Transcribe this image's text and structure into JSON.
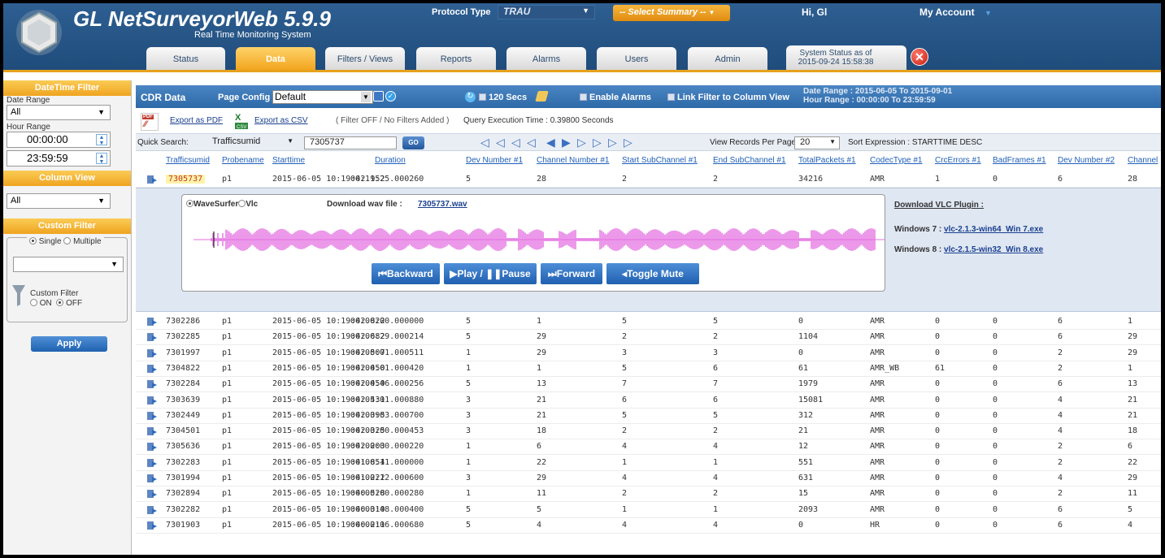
{
  "app": {
    "title": "GL NetSurveyorWeb 5.9.9",
    "subtitle": "Real Time Monitoring System",
    "protocol_label": "Protocol Type",
    "protocol_value": "TRAU",
    "summary_select": "-- Select Summary --",
    "greeting": "Hi, Gl",
    "my_account": "My Account"
  },
  "tabs": [
    {
      "label": "Status"
    },
    {
      "label": "Data"
    },
    {
      "label": "Filters / Views"
    },
    {
      "label": "Reports"
    },
    {
      "label": "Alarms"
    },
    {
      "label": "Users"
    },
    {
      "label": "Admin"
    }
  ],
  "system_status": {
    "line1": "System Status as of",
    "line2": "2015-09-24 15:58:38"
  },
  "sidebar": {
    "datetime_filter": "DateTime Filter",
    "date_range_label": "Date Range",
    "date_range_value": "All",
    "hour_range_label": "Hour Range",
    "hour_from": "00:00:00",
    "hour_to": "23:59:59",
    "column_view": "Column View",
    "column_view_value": "All",
    "custom_filter": "Custom Filter",
    "single": "Single",
    "multiple": "Multiple",
    "custom_filter_value": "",
    "custom_filter_toggle": "Custom Filter",
    "on": "ON",
    "off": "OFF",
    "apply": "Apply"
  },
  "toolbar": {
    "cdr_data": "CDR Data",
    "page_config_label": "Page Config",
    "page_config_value": "Default",
    "refresh_interval": "120 Secs",
    "enable_alarms": "Enable Alarms",
    "link_filter": "Link Filter to Column View",
    "date_range": "Date Range : 2015-06-05 To 2015-09-01",
    "hour_range": "Hour Range : 00:00:00 To 23:59:59"
  },
  "export": {
    "pdf": "Export as PDF",
    "csv": "Export as CSV",
    "filter_note": "( Filter OFF / No Filters Added )",
    "query_time": "Query Execution Time : 0.39800 Seconds"
  },
  "search": {
    "label": "Quick Search:",
    "field": "Trafficsumid",
    "value": "7305737",
    "go": "GO",
    "records_label": "View Records Per Page:",
    "records_value": "20",
    "sort_expression": "Sort Expression : STARTTIME DESC"
  },
  "columns": [
    "Trafficsumid",
    "Probename",
    "Starttime",
    "Duration",
    "Dev Number #1",
    "Channel Number #1",
    "Start SubChannel #1",
    "End SubChannel #1",
    "TotalPackets #1",
    "CodecType #1",
    "CrcErrors #1",
    "BadFrames #1",
    "Dev Number #2",
    "Channel"
  ],
  "rows": [
    [
      "7305737",
      "p1",
      "2015-06-05 10:19:42.952",
      "00:11:25.000260",
      "5",
      "28",
      "2",
      "2",
      "34216",
      "AMR",
      "1",
      "0",
      "6",
      "28"
    ],
    [
      "7302286",
      "p1",
      "2015-06-05 10:19:42.822",
      "00:00:00.000000",
      "5",
      "1",
      "5",
      "5",
      "0",
      "AMR",
      "0",
      "0",
      "6",
      "1"
    ],
    [
      "7302285",
      "p1",
      "2015-06-05 10:19:42.682",
      "00:00:29.000214",
      "5",
      "29",
      "2",
      "2",
      "1104",
      "AMR",
      "0",
      "0",
      "6",
      "29"
    ],
    [
      "7301997",
      "p1",
      "2015-06-05 10:19:42.507",
      "00:00:01.000511",
      "1",
      "29",
      "3",
      "3",
      "0",
      "AMR",
      "0",
      "0",
      "2",
      "29"
    ],
    [
      "7304822",
      "p1",
      "2015-06-05 10:19:42.450",
      "00:00:01.000420",
      "1",
      "1",
      "5",
      "6",
      "61",
      "AMR_WB",
      "61",
      "0",
      "2",
      "1"
    ],
    [
      "7302284",
      "p1",
      "2015-06-05 10:19:42.450",
      "00:00:46.000256",
      "5",
      "13",
      "7",
      "7",
      "1979",
      "AMR",
      "0",
      "0",
      "6",
      "13"
    ],
    [
      "7303639",
      "p1",
      "2015-06-05 10:19:42.431",
      "00:05:01.000880",
      "3",
      "21",
      "6",
      "6",
      "15081",
      "AMR",
      "0",
      "0",
      "4",
      "21"
    ],
    [
      "7302449",
      "p1",
      "2015-06-05 10:19:42.395",
      "00:00:03.000700",
      "3",
      "21",
      "5",
      "5",
      "312",
      "AMR",
      "0",
      "0",
      "4",
      "21"
    ],
    [
      "7304501",
      "p1",
      "2015-06-05 10:19:42.325",
      "00:00:00.000453",
      "3",
      "18",
      "2",
      "2",
      "21",
      "AMR",
      "0",
      "0",
      "4",
      "18"
    ],
    [
      "7305636",
      "p1",
      "2015-06-05 10:19:42.203",
      "00:00:00.000220",
      "1",
      "6",
      "4",
      "4",
      "12",
      "AMR",
      "0",
      "0",
      "2",
      "6"
    ],
    [
      "7302283",
      "p1",
      "2015-06-05 10:19:41.854",
      "00:00:11.000000",
      "1",
      "22",
      "1",
      "1",
      "551",
      "AMR",
      "0",
      "0",
      "2",
      "22"
    ],
    [
      "7301994",
      "p1",
      "2015-06-05 10:19:41.222",
      "00:00:12.000600",
      "3",
      "29",
      "4",
      "4",
      "631",
      "AMR",
      "0",
      "0",
      "4",
      "29"
    ],
    [
      "7302894",
      "p1",
      "2015-06-05 10:19:40.528",
      "00:00:00.000280",
      "1",
      "11",
      "2",
      "2",
      "15",
      "AMR",
      "0",
      "0",
      "2",
      "11"
    ],
    [
      "7302282",
      "p1",
      "2015-06-05 10:19:40.310",
      "00:00:48.000400",
      "5",
      "5",
      "1",
      "1",
      "2093",
      "AMR",
      "0",
      "0",
      "6",
      "5"
    ],
    [
      "7301903",
      "p1",
      "2015-06-05 10:19:40.211",
      "00:00:06.000680",
      "5",
      "4",
      "4",
      "4",
      "0",
      "HR",
      "0",
      "0",
      "6",
      "4"
    ]
  ],
  "player": {
    "wavesurfer": "WaveSurfer",
    "vlc": "Vlc",
    "download_label": "Download wav file :",
    "download_file": "7305737.wav",
    "backward": "Backward",
    "play_pause": "Play / ❚❚Pause",
    "forward": "Forward",
    "toggle_mute": "Toggle Mute",
    "waveform_color": "#e36de0"
  },
  "vlc_plugin": {
    "heading": "Download VLC Plugin :",
    "win7_label": "Windows 7 :",
    "win7_link": "vlc-2.1.3-win64_Win 7.exe",
    "win8_label": "Windows 8 :",
    "win8_link": "vlc-2.1.5-win32_Win 8.exe"
  },
  "colors": {
    "header": "#1f4c7b",
    "accent": "#efa420",
    "link": "#1f5fb8"
  }
}
